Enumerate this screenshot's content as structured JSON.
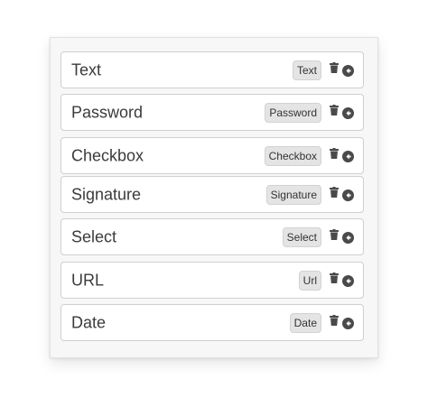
{
  "fields": [
    {
      "label": "Text",
      "type": "Text"
    },
    {
      "label": "Password",
      "type": "Password"
    },
    {
      "label": "Checkbox",
      "type": "Checkbox"
    },
    {
      "label": "Signature",
      "type": "Signature"
    },
    {
      "label": "Select",
      "type": "Select"
    },
    {
      "label": "URL",
      "type": "Url"
    },
    {
      "label": "Date",
      "type": "Date"
    }
  ],
  "icons": {
    "delete": "trash-icon",
    "remove": "circle-arrow-left-icon"
  },
  "colors": {
    "icon": "#4a4a4a",
    "badge_bg": "#e4e4e4",
    "border": "#cfcfcf"
  }
}
